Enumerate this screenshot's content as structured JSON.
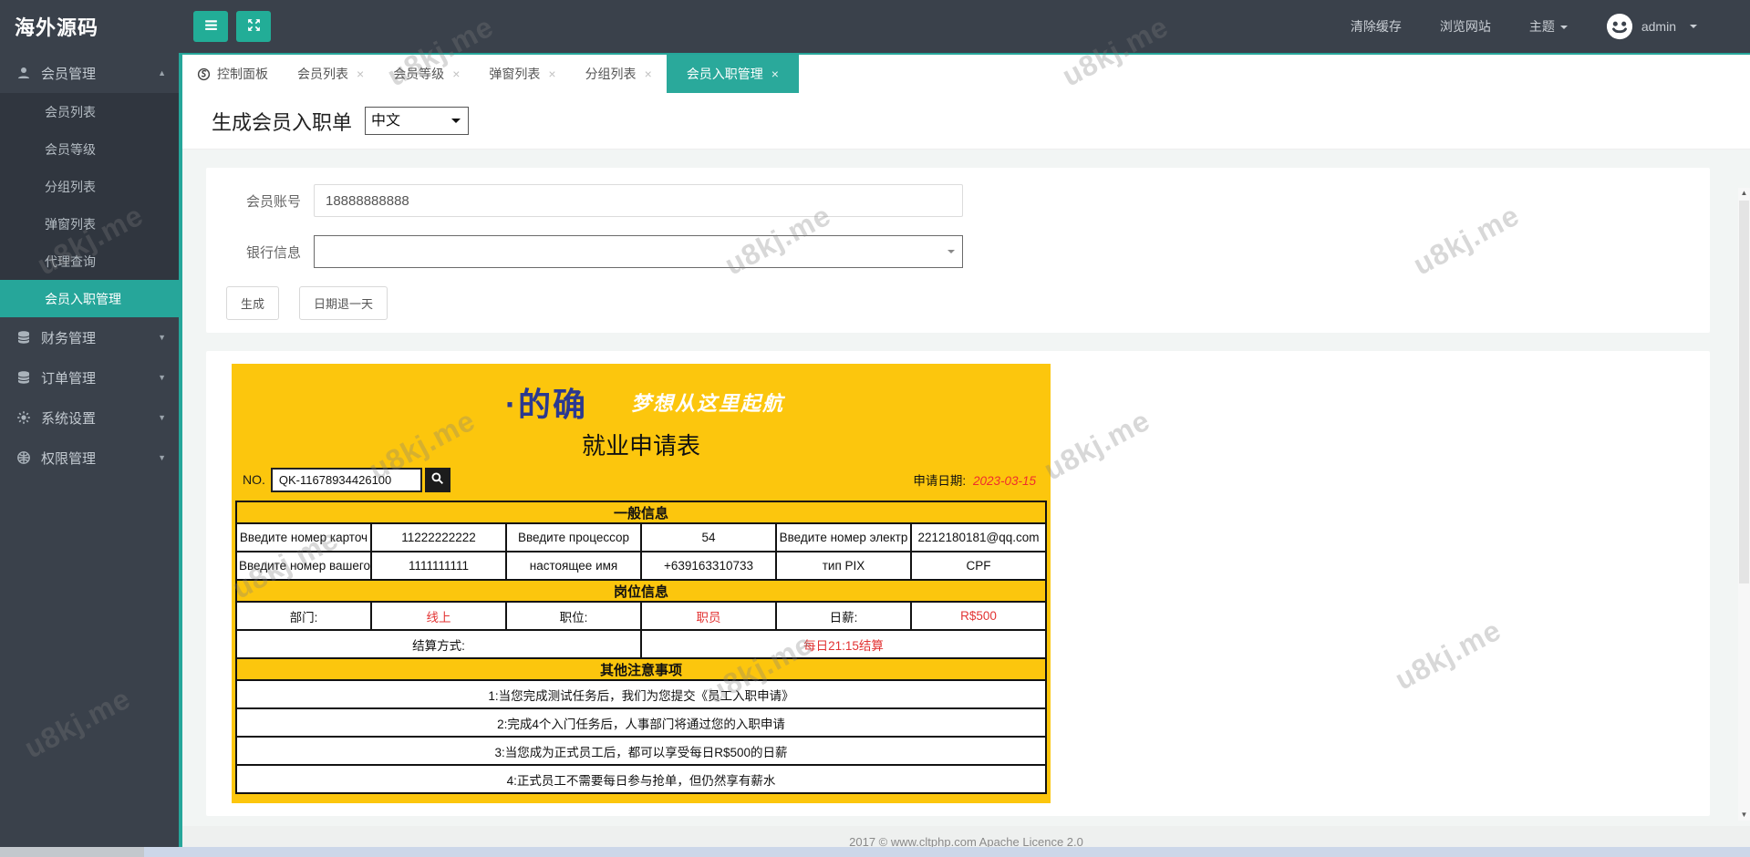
{
  "brand": "海外源码",
  "navbar": {
    "links": {
      "clear_cache": "清除缓存",
      "browse_site": "浏览网站",
      "theme": "主题",
      "username": "admin"
    }
  },
  "sidebar": {
    "groups": [
      {
        "label": "会员管理"
      },
      {
        "label": "财务管理"
      },
      {
        "label": "订单管理"
      },
      {
        "label": "系统设置"
      },
      {
        "label": "权限管理"
      }
    ],
    "member_children": [
      "会员列表",
      "会员等级",
      "分组列表",
      "弹窗列表",
      "代理查询",
      "会员入职管理"
    ]
  },
  "tabs": [
    {
      "label": "控制面板"
    },
    {
      "label": "会员列表"
    },
    {
      "label": "会员等级"
    },
    {
      "label": "弹窗列表"
    },
    {
      "label": "分组列表"
    },
    {
      "label": "会员入职管理"
    }
  ],
  "page": {
    "title": "生成会员入职单",
    "lang_selected": "中文",
    "fields": [
      {
        "label": "会员账号",
        "value": "18888888888"
      },
      {
        "label": "银行信息",
        "value": ""
      }
    ],
    "buttons": {
      "generate": "生成",
      "date_back": "日期退一天"
    }
  },
  "doc": {
    "brand": "·的确",
    "slogan": "梦想从这里起航",
    "title": "就业申请表",
    "no_label": "NO.",
    "no_value": "QK-11678934426100",
    "date_label": "申请日期:",
    "date_value": "2023-03-15",
    "general": {
      "header": "一般信息",
      "rows": [
        [
          "Введите номер карточ",
          "11222222222",
          "Введите процессор",
          "54",
          "Введите номер электр",
          "2212180181@qq.com"
        ],
        [
          "Введите номер вашего",
          "1111111111",
          "настоящее имя",
          "+639163310733",
          "тип PIX",
          "CPF"
        ]
      ]
    },
    "position": {
      "header": "岗位信息",
      "row": [
        "部门:",
        "线上",
        "职位:",
        "职员",
        "日薪:",
        "R$500"
      ],
      "settle_label": "结算方式:",
      "settle_value": "每日21:15结算"
    },
    "notes": {
      "header": "其他注意事项",
      "items": [
        "1:当您完成测试任务后，我们为您提交《员工入职申请》",
        "2:完成4个入门任务后，人事部门将通过您的入职申请",
        "3:当您成为正式员工后，都可以享受每日R$500的日薪",
        "4:正式员工不需要每日参与抢单，但仍然享有薪水"
      ]
    }
  },
  "footer": "2017 ©  www.cltphp.com  Apache Licence 2.0",
  "watermark": "u8kj.me",
  "colors": {
    "accent": "#26a69a",
    "sidebar": "#3a414b",
    "yellow": "#fcc60d",
    "navy": "#2b3990",
    "red": "#e23333"
  }
}
